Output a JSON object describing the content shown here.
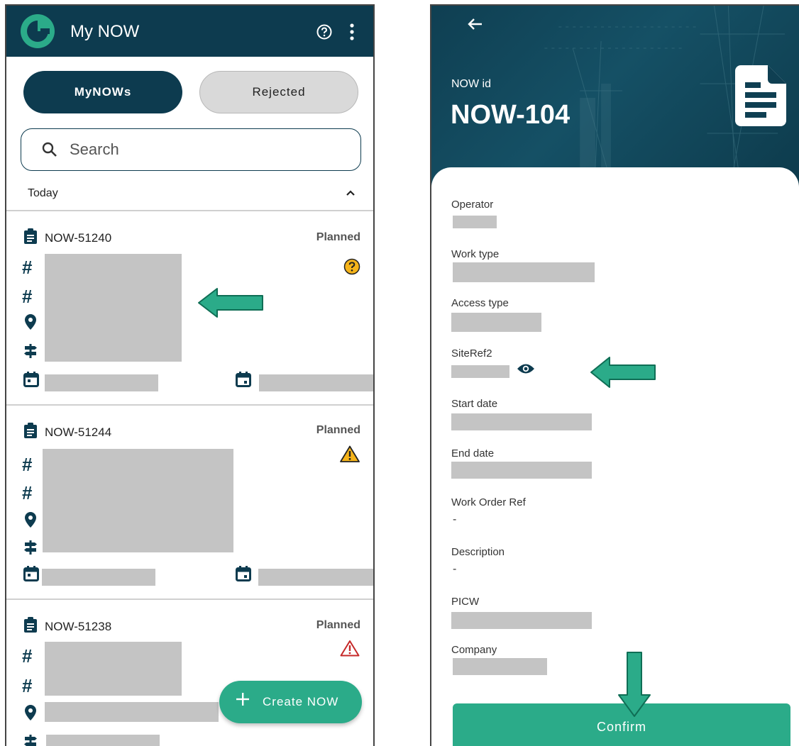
{
  "colors": {
    "primary": "#0d3b4f",
    "accent": "#2bab89",
    "redaction": "#c4c4c4",
    "warning_yellow": "#f6b41a",
    "warning_red": "#c62828"
  },
  "list_screen": {
    "app_title": "My NOW",
    "icons": {
      "logo": "brand-logo-icon",
      "help": "help-circle-icon",
      "menu": "more-vert-icon"
    },
    "tabs": [
      {
        "label": "MyNOWs",
        "active": true
      },
      {
        "label": "Rejected",
        "active": false
      }
    ],
    "search": {
      "placeholder": "Search",
      "value": ""
    },
    "group": {
      "label": "Today",
      "expanded": true
    },
    "cards": [
      {
        "id": "NOW-51240",
        "status": "Planned",
        "alert_icon": "question-circle-icon"
      },
      {
        "id": "NOW-51244",
        "status": "Planned",
        "alert_icon": "warning-triangle-filled-icon"
      },
      {
        "id": "NOW-51238",
        "status": "Planned",
        "alert_icon": "warning-triangle-outline-icon"
      }
    ],
    "row_icons": {
      "clipboard": "clipboard-icon",
      "hash": "#",
      "location": "location-pin-icon",
      "signpost": "signpost-icon",
      "start_date": "calendar-start-icon",
      "end_date": "calendar-end-icon"
    },
    "fab": {
      "label": "Create NOW"
    }
  },
  "detail_screen": {
    "header": {
      "label": "NOW id",
      "now_id": "NOW-104"
    },
    "fields": [
      {
        "label": "Operator",
        "value": null
      },
      {
        "label": "Work type",
        "value": null
      },
      {
        "label": "Access type",
        "value": null
      },
      {
        "label": "SiteRef2",
        "value": null
      },
      {
        "label": "Start date",
        "value": null
      },
      {
        "label": "End date",
        "value": null
      },
      {
        "label": "Work Order Ref",
        "value": "-"
      },
      {
        "label": "Description",
        "value": "-"
      },
      {
        "label": "PICW",
        "value": null
      },
      {
        "label": "Company",
        "value": null
      }
    ],
    "confirm_button": {
      "label": "Confirm"
    }
  }
}
